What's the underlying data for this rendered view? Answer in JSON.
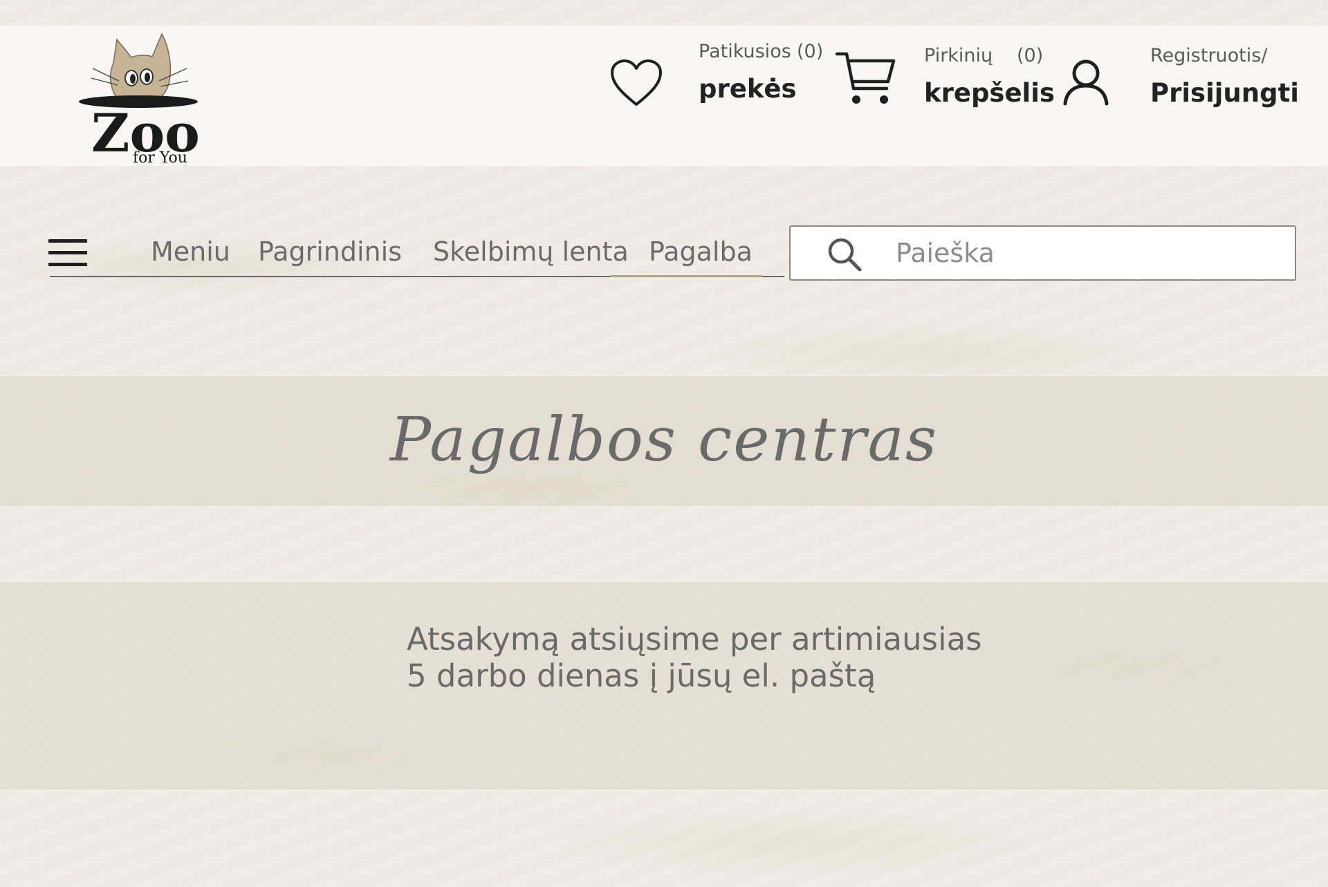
{
  "brand": {
    "logo_main": "Zoo",
    "logo_sub": "for You"
  },
  "header": {
    "favorites": {
      "small_label": "Patikusios",
      "count": "(0)",
      "big_label": "prekės",
      "icon": "heart-icon"
    },
    "cart": {
      "small_label": "Pirkinių",
      "count": "(0)",
      "big_label": "krepšelis",
      "icon": "cart-icon"
    },
    "account": {
      "small_label": "Registruotis/",
      "big_label": "Prisijungti",
      "icon": "user-icon"
    }
  },
  "nav": {
    "menu_icon": "hamburger-icon",
    "items": [
      {
        "label": "Meniu",
        "active": false
      },
      {
        "label": "Pagrindinis",
        "active": false
      },
      {
        "label": "Skelbimų lenta",
        "active": false
      },
      {
        "label": "Pagalba",
        "active": true
      }
    ]
  },
  "search": {
    "placeholder": "Paieška",
    "value": "",
    "icon": "search-icon"
  },
  "main": {
    "title": "Pagalbos centras",
    "message_lines": [
      "Atsakymą atsiųsime per artimiausias",
      "5 darbo dienas į jūsų el. paštą"
    ]
  },
  "colors": {
    "accent_underline": "#b0a48c",
    "band": "#ded5c8",
    "text": "#6a6a6a"
  }
}
